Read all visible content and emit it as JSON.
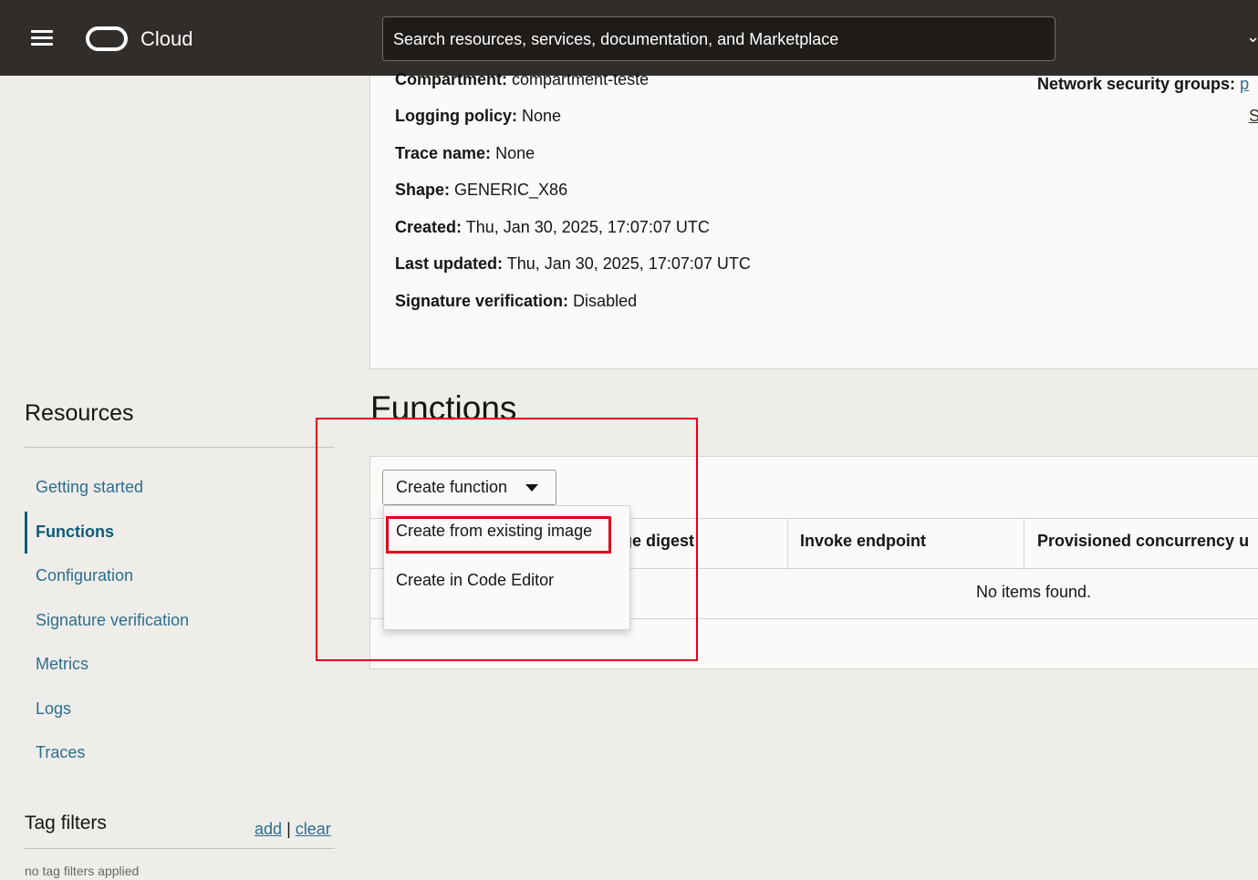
{
  "header": {
    "brand": "Cloud",
    "search_placeholder": "Search resources, services, documentation, and Marketplace",
    "chevron": "⌄"
  },
  "details": {
    "compartment": {
      "label": "Compartment:",
      "value": "compartment-teste"
    },
    "logging": {
      "label": "Logging policy:",
      "value": "None"
    },
    "trace": {
      "label": "Trace name:",
      "value": "None"
    },
    "shape": {
      "label": "Shape:",
      "value": "GENERIC_X86"
    },
    "created": {
      "label": "Created:",
      "value": "Thu, Jan 30, 2025, 17:07:07 UTC"
    },
    "updated": {
      "label": "Last updated:",
      "value": "Thu, Jan 30, 2025, 17:07:07 UTC"
    },
    "signature": {
      "label": "Signature verification:",
      "value": "Disabled"
    },
    "nsg": {
      "label": "Network security groups:",
      "link": "p",
      "second_link": "S"
    }
  },
  "sidebar": {
    "title": "Resources",
    "items": [
      {
        "label": "Getting started"
      },
      {
        "label": "Functions"
      },
      {
        "label": "Configuration"
      },
      {
        "label": "Signature verification"
      },
      {
        "label": "Metrics"
      },
      {
        "label": "Logs"
      },
      {
        "label": "Traces"
      }
    ],
    "tag_filters": {
      "title": "Tag filters",
      "add": "add",
      "separator": "|",
      "clear": "clear",
      "empty": "no tag filters applied"
    }
  },
  "functions": {
    "title": "Functions",
    "create_button": "Create function",
    "menu": [
      "Create from existing image",
      "Create in Code Editor"
    ],
    "columns": [
      "ge digest",
      "Invoke endpoint",
      "Provisioned concurrency u"
    ],
    "empty_text": "No items found."
  },
  "colors": {
    "header_bg": "#312d2a",
    "link": "#2c6e8e",
    "highlight": "#e2001a"
  }
}
